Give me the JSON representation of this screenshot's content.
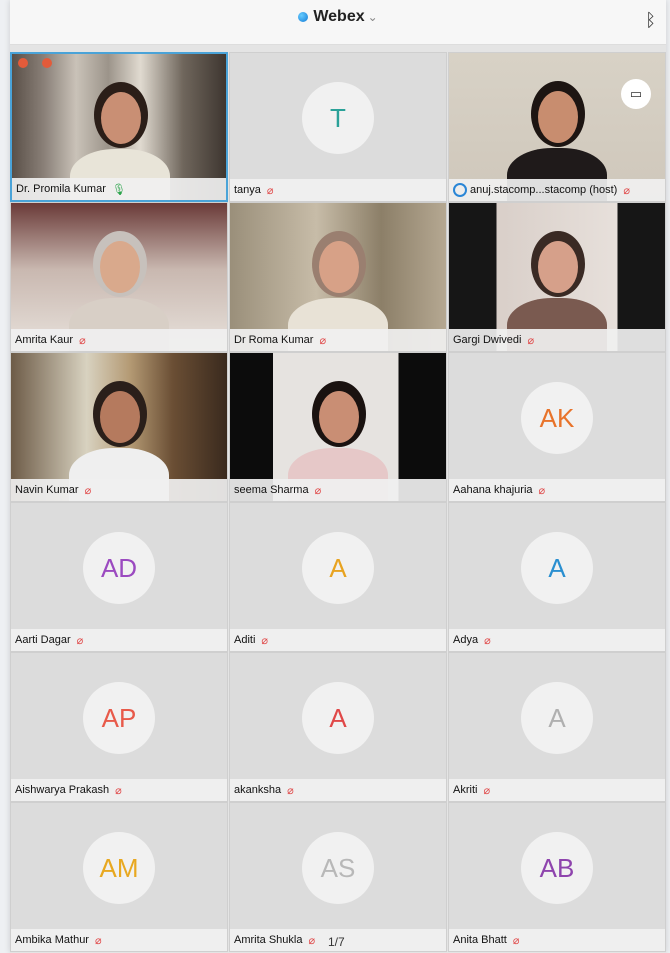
{
  "app": {
    "title": "Webex",
    "logo_icon": "webex-logo-icon",
    "menu_icon": "chevron-down-icon",
    "status_icon": "bluetooth-icon"
  },
  "page_indicator": "1/7",
  "participants": [
    {
      "name": "Dr. Promila Kumar",
      "mic": "on",
      "type": "video",
      "active": true
    },
    {
      "name": "tanya",
      "mic": "muted",
      "type": "avatar",
      "initials": "T",
      "color": "#2aa198"
    },
    {
      "name": "anuj.stacomp...stacomp (host)",
      "mic": "muted",
      "type": "video",
      "host": true
    },
    {
      "name": "Amrita Kaur",
      "mic": "muted",
      "type": "video"
    },
    {
      "name": "Dr Roma Kumar",
      "mic": "muted",
      "type": "video"
    },
    {
      "name": "Gargi Dwivedi",
      "mic": "muted",
      "type": "video"
    },
    {
      "name": "Navin Kumar",
      "mic": "muted",
      "type": "video"
    },
    {
      "name": "seema Sharma",
      "mic": "muted",
      "type": "video"
    },
    {
      "name": "Aahana khajuria",
      "mic": "muted",
      "type": "avatar",
      "initials": "AK",
      "color": "#e8732a"
    },
    {
      "name": "Aarti Dagar",
      "mic": "muted",
      "type": "avatar",
      "initials": "AD",
      "color": "#9b4ac0"
    },
    {
      "name": "Aditi",
      "mic": "muted",
      "type": "avatar",
      "initials": "A",
      "color": "#e8a320"
    },
    {
      "name": "Adya",
      "mic": "muted",
      "type": "avatar",
      "initials": "A",
      "color": "#2a8fd0"
    },
    {
      "name": "Aishwarya Prakash",
      "mic": "muted",
      "type": "avatar",
      "initials": "AP",
      "color": "#e85a4a"
    },
    {
      "name": "akanksha",
      "mic": "muted",
      "type": "avatar",
      "initials": "A",
      "color": "#e04848"
    },
    {
      "name": "Akriti",
      "mic": "muted",
      "type": "avatar",
      "initials": "A",
      "color": "#b0b0b0"
    },
    {
      "name": "Ambika Mathur",
      "mic": "muted",
      "type": "avatar",
      "initials": "AM",
      "color": "#e8a820"
    },
    {
      "name": "Amrita Shukla",
      "mic": "muted",
      "type": "avatar",
      "initials": "AS",
      "color": "#b8b8b8"
    },
    {
      "name": "Anita Bhatt",
      "mic": "muted",
      "type": "avatar",
      "initials": "AB",
      "color": "#8e44ad"
    }
  ]
}
